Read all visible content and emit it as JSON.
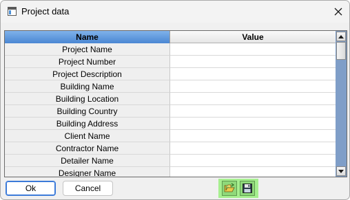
{
  "window": {
    "title": "Project data",
    "icons": {
      "app": "window-app-icon",
      "close": "close-icon"
    }
  },
  "grid": {
    "columns": {
      "name": "Name",
      "value": "Value"
    },
    "rows": [
      {
        "name": "Project Name",
        "value": ""
      },
      {
        "name": "Project Number",
        "value": ""
      },
      {
        "name": "Project Description",
        "value": ""
      },
      {
        "name": "Building Name",
        "value": ""
      },
      {
        "name": "Building Location",
        "value": ""
      },
      {
        "name": "Building Country",
        "value": ""
      },
      {
        "name": "Building Address",
        "value": ""
      },
      {
        "name": "Client Name",
        "value": ""
      },
      {
        "name": "Contractor Name",
        "value": ""
      },
      {
        "name": "Detailer Name",
        "value": ""
      },
      {
        "name": "Designer Name",
        "value": ""
      }
    ],
    "header_active_color": "#4a86d3",
    "scrollbar_track_color": "#7f9ec8"
  },
  "buttons": {
    "ok": "Ok",
    "cancel": "Cancel"
  },
  "toolbar": {
    "open_icon": "open-folder-icon",
    "save_icon": "floppy-disk-save-icon",
    "highlight_color": "#a6ef8f"
  }
}
